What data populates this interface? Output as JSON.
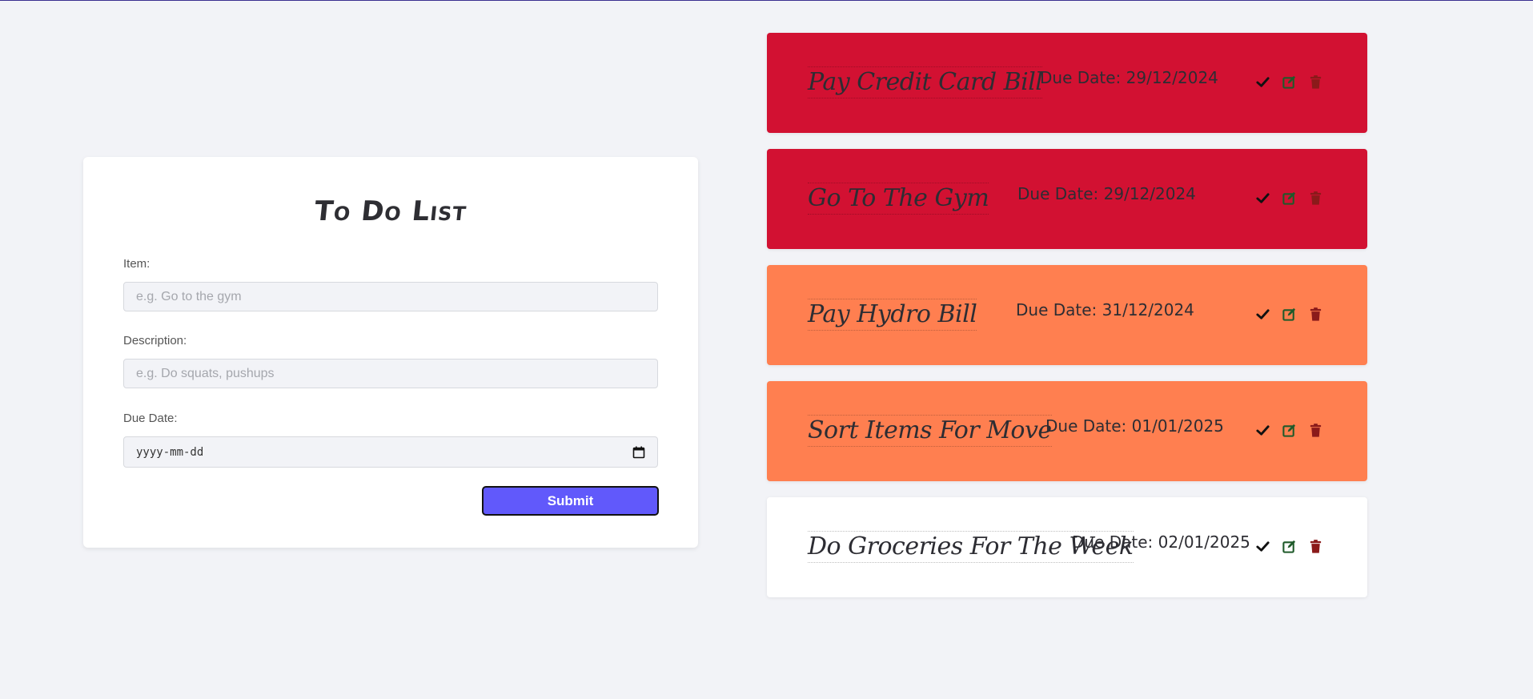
{
  "form": {
    "title": "To Do List",
    "item_label": "Item:",
    "item_placeholder": "e.g. Go to the gym",
    "description_label": "Description:",
    "description_placeholder": "e.g. Do squats, pushups",
    "due_label": "Due Date:",
    "due_placeholder": "yyyy-mm-dd",
    "submit_label": "Submit"
  },
  "tasks": [
    {
      "title": "Pay Credit Card Bill",
      "due": "Due Date: 29/12/2024",
      "color": "#d21132",
      "icons": [
        "check-icon",
        "edit-icon",
        "trash-icon"
      ]
    },
    {
      "title": "Go To The Gym",
      "due": "Due Date: 29/12/2024",
      "color": "#d21132",
      "icons": [
        "check-icon",
        "edit-icon",
        "trash-icon"
      ]
    },
    {
      "title": "Pay Hydro Bill",
      "due": "Due Date: 31/12/2024",
      "color": "#ff7f50",
      "icons": [
        "check-icon",
        "edit-icon",
        "trash-icon"
      ]
    },
    {
      "title": "Sort Items For Move",
      "due": "Due Date: 01/01/2025",
      "color": "#ff7f50",
      "icons": [
        "check-icon",
        "edit-icon",
        "trash-icon"
      ]
    },
    {
      "title": "Do Groceries For The Week",
      "due": "Due Date: 02/01/2025",
      "color": "#ffffff",
      "icons": [
        "check-icon",
        "edit-icon",
        "trash-icon"
      ]
    }
  ],
  "colors": {
    "accent": "#6159fb",
    "overdue": "#d21132",
    "soon": "#ff7f50",
    "normal": "#ffffff",
    "background": "#f2f3f7"
  }
}
